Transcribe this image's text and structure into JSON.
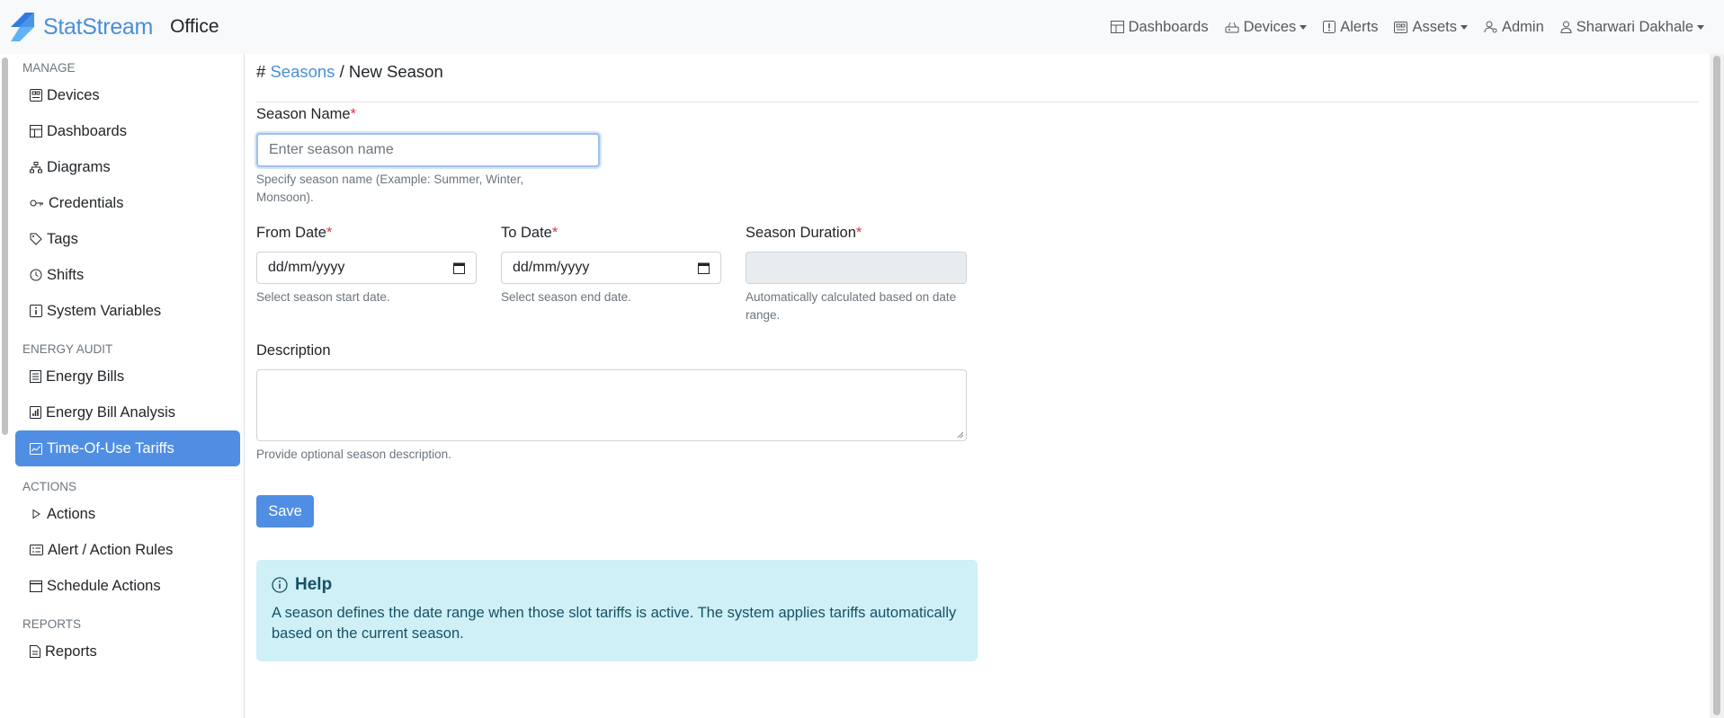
{
  "brand": {
    "name": "StatStream",
    "app": "Office",
    "logo_colors": [
      "#2f7be0",
      "#5fb3f5"
    ]
  },
  "topnav": {
    "items": [
      {
        "label": "Dashboards",
        "icon": "dashboard-icon",
        "dropdown": false
      },
      {
        "label": "Devices",
        "icon": "devices-icon",
        "dropdown": true
      },
      {
        "label": "Alerts",
        "icon": "alert-icon",
        "dropdown": false
      },
      {
        "label": "Assets",
        "icon": "assets-icon",
        "dropdown": true
      },
      {
        "label": "Admin",
        "icon": "admin-icon",
        "dropdown": false
      },
      {
        "label": "Sharwari Dakhale",
        "icon": "user-icon",
        "dropdown": true
      }
    ]
  },
  "sidebar": {
    "sections": [
      {
        "title": "MANAGE",
        "items": [
          {
            "label": "Devices",
            "icon": "devices-icon"
          },
          {
            "label": "Dashboards",
            "icon": "dashboard-icon"
          },
          {
            "label": "Diagrams",
            "icon": "diagram-icon"
          },
          {
            "label": "Credentials",
            "icon": "key-icon"
          },
          {
            "label": "Tags",
            "icon": "tag-icon"
          },
          {
            "label": "Shifts",
            "icon": "clock-icon"
          },
          {
            "label": "System Variables",
            "icon": "info-icon"
          }
        ]
      },
      {
        "title": "ENERGY AUDIT",
        "items": [
          {
            "label": "Energy Bills",
            "icon": "bill-icon"
          },
          {
            "label": "Energy Bill Analysis",
            "icon": "chart-icon"
          },
          {
            "label": "Time-Of-Use Tariffs",
            "icon": "tariff-icon",
            "active": true
          }
        ]
      },
      {
        "title": "ACTIONS",
        "items": [
          {
            "label": "Actions",
            "icon": "play-icon"
          },
          {
            "label": "Alert / Action Rules",
            "icon": "rules-icon"
          },
          {
            "label": "Schedule Actions",
            "icon": "calendar-icon"
          }
        ]
      },
      {
        "title": "REPORTS",
        "items": [
          {
            "label": "Reports",
            "icon": "report-icon"
          }
        ]
      }
    ],
    "active_color": "#4f8ee3"
  },
  "breadcrumb": {
    "hash": "#",
    "parent": "Seasons",
    "separator": "/",
    "current": "New Season"
  },
  "form": {
    "season_name": {
      "label": "Season Name",
      "required": "*",
      "placeholder": "Enter season name",
      "value": "",
      "help": "Specify season name (Example: Summer, Winter, Monsoon)."
    },
    "from_date": {
      "label": "From Date",
      "required": "*",
      "placeholder": "dd/mm/yyyy",
      "help": "Select season start date."
    },
    "to_date": {
      "label": "To Date",
      "required": "*",
      "placeholder": "dd/mm/yyyy",
      "help": "Select season end date."
    },
    "duration": {
      "label": "Season Duration",
      "required": "*",
      "value": "",
      "help": "Automatically calculated based on date range."
    },
    "description": {
      "label": "Description",
      "value": "",
      "help": "Provide optional season description."
    },
    "save_label": "Save"
  },
  "help": {
    "title": "Help",
    "body": "A season defines the date range when those slot tariffs is active. The system applies tariffs automatically based on the current season.",
    "bg_color": "#cff0f7"
  }
}
